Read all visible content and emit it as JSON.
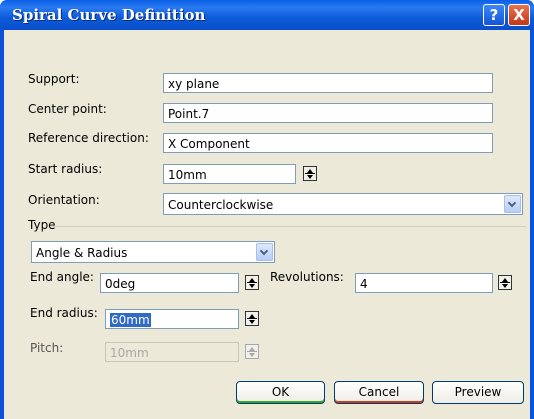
{
  "window": {
    "title": "Spiral Curve Definition",
    "help_label": "?",
    "close_label": "X"
  },
  "support": {
    "label": "Support:",
    "value": "xy plane"
  },
  "center_point": {
    "label": "Center point:",
    "value": "Point.7"
  },
  "reference_direction": {
    "label": "Reference direction:",
    "value": "X Component"
  },
  "start_radius": {
    "label": "Start radius:",
    "value": "10mm"
  },
  "orientation": {
    "label": "Orientation:",
    "value": "Counterclockwise"
  },
  "type": {
    "group_label": "Type",
    "value": "Angle & Radius"
  },
  "end_angle": {
    "label": "End angle:",
    "value": "0deg"
  },
  "revolutions": {
    "label": "Revolutions:",
    "value": "4"
  },
  "end_radius": {
    "label": "End radius:",
    "value": "60mm"
  },
  "pitch": {
    "label": "Pitch:",
    "value": "10mm"
  },
  "buttons": {
    "ok": "OK",
    "cancel": "Cancel",
    "preview": "Preview"
  }
}
